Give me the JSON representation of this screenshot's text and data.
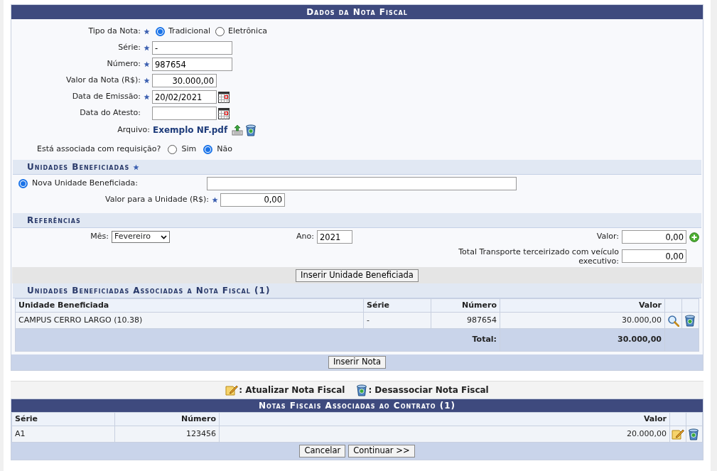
{
  "panel_title": "Dados da Nota Fiscal",
  "tipo": {
    "label": "Tipo da Nota:",
    "required": true,
    "options": [
      {
        "label": "Tradicional",
        "selected": true
      },
      {
        "label": "Eletrônica",
        "selected": false
      }
    ]
  },
  "fields": [
    {
      "kind": "text",
      "label": "Série:",
      "required": true,
      "value": "-"
    },
    {
      "kind": "text",
      "label": "Número:",
      "required": true,
      "value": "987654"
    },
    {
      "kind": "money",
      "label": "Valor da Nota (R$):",
      "required": true,
      "value": "30.000,00"
    },
    {
      "kind": "date",
      "label": "Data de Emissão:",
      "required": true,
      "value": "20/02/2021"
    },
    {
      "kind": "date",
      "label": "Data do Atesto:",
      "required": false
    }
  ],
  "arquivo": {
    "label": "Arquivo:",
    "file": "Exemplo NF.pdf"
  },
  "requisicao": {
    "label": "Está associada com requisição?",
    "options": [
      {
        "label": "Sim",
        "selected": false
      },
      {
        "label": "Não",
        "selected": true
      }
    ]
  },
  "unidades": {
    "title": "Unidades Beneficiadas",
    "required": true,
    "nova": {
      "label": "Nova Unidade Beneficiada:",
      "selected": true
    },
    "valor": {
      "label": "Valor para a Unidade (R$):",
      "required": true,
      "value": "0,00"
    }
  },
  "referencias": {
    "title": "Referências",
    "mes": {
      "label": "Mês:",
      "value": "Fevereiro"
    },
    "ano": {
      "label": "Ano:",
      "value": "2021"
    },
    "valor": {
      "label": "Valor:",
      "value": "0,00"
    },
    "transporte": {
      "label": "Total Transporte terceirizado com veículo executivo:",
      "value": "0,00"
    }
  },
  "insert_unit_button": "Inserir Unidade Beneficiada",
  "assoc": {
    "title": "Unidades Beneficiadas Associadas a Nota Fiscal (1)",
    "columns": [
      "Unidade Beneficiada",
      "Série",
      "Número",
      "Valor"
    ],
    "rows": [
      {
        "unidade": "CAMPUS CERRO LARGO (10.38)",
        "serie": "-",
        "numero": "987654",
        "valor": "30.000,00"
      }
    ],
    "total_label": "Total:",
    "total": "30.000,00"
  },
  "insert_note_button": "Inserir Nota",
  "legend": [
    {
      "kind": "edit",
      "label": ": Atualizar Nota Fiscal"
    },
    {
      "kind": "delete",
      "label": ": Desassociar Nota Fiscal"
    }
  ],
  "contract": {
    "title": "Notas Fiscais Associadas ao Contrato (1)",
    "columns": [
      "Série",
      "Número",
      "Valor"
    ],
    "rows": [
      {
        "serie": "A1",
        "numero": "123456",
        "valor": "20.000,00"
      }
    ]
  },
  "buttons": [
    "Cancelar",
    "Continuar >>"
  ]
}
